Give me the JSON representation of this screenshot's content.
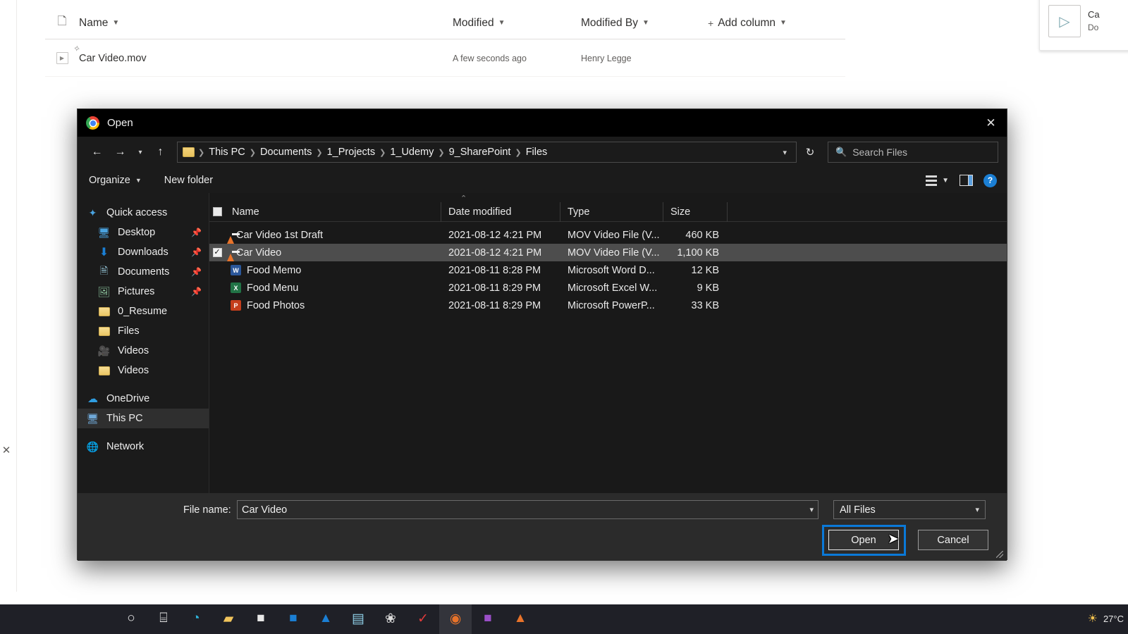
{
  "sharepoint": {
    "columns": [
      {
        "label": "Name",
        "icon": "chevron-down-icon"
      },
      {
        "label": "Modified",
        "icon": "chevron-down-icon"
      },
      {
        "label": "Modified By",
        "icon": "chevron-down-icon"
      },
      {
        "label": "Add column",
        "icon": "plus-icon"
      }
    ],
    "rows": [
      {
        "name": "Car Video.mov",
        "modified": "A few seconds ago",
        "modified_by": "Henry Legge",
        "icon": "video-file-icon"
      }
    ],
    "toast": {
      "title": "Ca",
      "subtitle": "Do",
      "icon": "play-icon"
    },
    "close_icon": "close-icon"
  },
  "dialog": {
    "title": "Open",
    "app_icon": "chrome-icon",
    "close_label": "✕",
    "nav": {
      "back_icon": "arrow-left-icon",
      "forward_icon": "arrow-right-icon",
      "recent_icon": "chevron-down-icon",
      "up_icon": "arrow-up-icon",
      "refresh_icon": "refresh-icon",
      "dropdown_icon": "chevron-down-icon"
    },
    "breadcrumb": [
      "This PC",
      "Documents",
      "1_Projects",
      "1_Udemy",
      "9_SharePoint",
      "Files"
    ],
    "search": {
      "placeholder": "Search Files",
      "icon": "search-icon"
    },
    "commands": [
      {
        "label": "Organize",
        "caret": "▾"
      },
      {
        "label": "New folder",
        "caret": ""
      }
    ],
    "view_icons": [
      {
        "name": "view-layout-icon"
      },
      {
        "name": "view-dropdown-icon"
      },
      {
        "name": "preview-pane-icon"
      },
      {
        "name": "help-icon",
        "label": "?"
      }
    ],
    "sidebar": [
      {
        "label": "Quick access",
        "icon": "star-icon",
        "pin": false,
        "indent": false,
        "selected": false
      },
      {
        "label": "Desktop",
        "icon": "desktop-icon",
        "pin": true,
        "indent": true,
        "selected": false
      },
      {
        "label": "Downloads",
        "icon": "download-icon",
        "pin": true,
        "indent": true,
        "selected": false
      },
      {
        "label": "Documents",
        "icon": "documents-icon",
        "pin": true,
        "indent": true,
        "selected": false
      },
      {
        "label": "Pictures",
        "icon": "pictures-icon",
        "pin": true,
        "indent": true,
        "selected": false
      },
      {
        "label": "0_Resume",
        "icon": "folder-icon",
        "pin": false,
        "indent": true,
        "selected": false
      },
      {
        "label": "Files",
        "icon": "folder-icon",
        "pin": false,
        "indent": true,
        "selected": false
      },
      {
        "label": "Videos",
        "icon": "videos-library-icon",
        "pin": false,
        "indent": true,
        "selected": false
      },
      {
        "label": "Videos",
        "icon": "folder-icon",
        "pin": false,
        "indent": true,
        "selected": false
      },
      {
        "label": "OneDrive",
        "icon": "onedrive-icon",
        "pin": false,
        "indent": false,
        "selected": false
      },
      {
        "label": "This PC",
        "icon": "this-pc-icon",
        "pin": false,
        "indent": false,
        "selected": true
      },
      {
        "label": "Network",
        "icon": "network-icon",
        "pin": false,
        "indent": false,
        "selected": false
      }
    ],
    "file_list": {
      "sort_indicator": "⌃",
      "headers": [
        "Name",
        "Date modified",
        "Type",
        "Size"
      ],
      "rows": [
        {
          "name": "Car Video 1st Draft",
          "date": "2021-08-12 4:21 PM",
          "type": "MOV Video File (V...",
          "size": "460 KB",
          "icon": "vlc-icon",
          "checked": false,
          "selected": false
        },
        {
          "name": "Car Video",
          "date": "2021-08-12 4:21 PM",
          "type": "MOV Video File (V...",
          "size": "1,100 KB",
          "icon": "vlc-icon",
          "checked": true,
          "selected": true
        },
        {
          "name": "Food Memo",
          "date": "2021-08-11 8:28 PM",
          "type": "Microsoft Word D...",
          "size": "12 KB",
          "icon": "word-icon",
          "checked": false,
          "selected": false
        },
        {
          "name": "Food Menu",
          "date": "2021-08-11 8:29 PM",
          "type": "Microsoft Excel W...",
          "size": "9 KB",
          "icon": "excel-icon",
          "checked": false,
          "selected": false
        },
        {
          "name": "Food Photos",
          "date": "2021-08-11 8:29 PM",
          "type": "Microsoft PowerP...",
          "size": "33 KB",
          "icon": "powerpoint-icon",
          "checked": false,
          "selected": false
        }
      ]
    },
    "footer": {
      "file_name_label": "File name:",
      "file_name_value": "Car Video",
      "filter_value": "All Files",
      "open_button": "Open",
      "cancel_button": "Cancel"
    },
    "accent_color": "#0a79d8"
  },
  "taskbar": {
    "items": [
      {
        "name": "search-icon",
        "glyph": "○",
        "color": "#e8e8e8",
        "active": false
      },
      {
        "name": "task-view-icon",
        "glyph": "⌸",
        "color": "#e8e8e8",
        "active": false
      },
      {
        "name": "edge-icon",
        "glyph": "◔",
        "color": "#2fb3d9",
        "active": false
      },
      {
        "name": "file-explorer-icon",
        "glyph": "▰",
        "color": "#f2c55c",
        "active": false
      },
      {
        "name": "store-icon",
        "glyph": "■",
        "color": "#e8e8e8",
        "active": false
      },
      {
        "name": "outlook-icon",
        "glyph": "■",
        "color": "#1b7fd4",
        "active": false
      },
      {
        "name": "onedrive-icon",
        "glyph": "▲",
        "color": "#1b7fd4",
        "active": false
      },
      {
        "name": "calculator-icon",
        "glyph": "▤",
        "color": "#8fd0e8",
        "active": false
      },
      {
        "name": "paint-icon",
        "glyph": "❀",
        "color": "#dcdcdc",
        "active": false
      },
      {
        "name": "todo-icon",
        "glyph": "✓",
        "color": "#e23b3b",
        "active": false
      },
      {
        "name": "chrome-icon",
        "glyph": "◉",
        "color": "#e8732a",
        "active": true
      },
      {
        "name": "onenote-icon",
        "glyph": "■",
        "color": "#9b4fc8",
        "active": false
      },
      {
        "name": "vlc-icon",
        "glyph": "▲",
        "color": "#e8732a",
        "active": false
      }
    ],
    "weather": {
      "icon": "sun-icon",
      "label": "27°C"
    }
  }
}
